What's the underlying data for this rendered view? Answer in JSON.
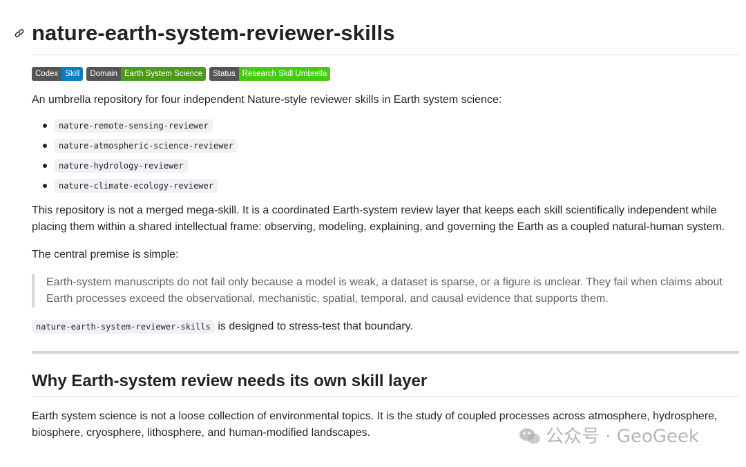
{
  "heading": "nature-earth-system-reviewer-skills",
  "badges": [
    {
      "key": "Codex",
      "value": "Skill",
      "color": "#007ec6"
    },
    {
      "key": "Domain",
      "value": "Earth System Science",
      "color": "#4c9a1a"
    },
    {
      "key": "Status",
      "value": "Research Skill Umbrella",
      "color": "#44cc11"
    }
  ],
  "intro": "An umbrella repository for four independent Nature-style reviewer skills in Earth system science:",
  "skills": [
    "nature-remote-sensing-reviewer",
    "nature-atmospheric-science-reviewer",
    "nature-hydrology-reviewer",
    "nature-climate-ecology-reviewer"
  ],
  "paragraph2": "This repository is not a merged mega-skill. It is a coordinated Earth-system review layer that keeps each skill scientifically independent while placing them within a shared intellectual frame: observing, modeling, explaining, and governing the Earth as a coupled natural-human system.",
  "paragraph3": "The central premise is simple:",
  "quote": "Earth-system manuscripts do not fail only because a model is weak, a dataset is sparse, or a figure is unclear. They fail when claims about Earth processes exceed the observational, mechanistic, spatial, temporal, and causal evidence that supports them.",
  "paragraph4": {
    "code": "nature-earth-system-reviewer-skills",
    "text": " is designed to stress-test that boundary."
  },
  "section2": {
    "heading": "Why Earth-system review needs its own skill layer",
    "paragraph": "Earth system science is not a loose collection of environmental topics. It is the study of coupled processes across atmosphere, hydrosphere, biosphere, cryosphere, lithosphere, and human-modified landscapes."
  },
  "watermark": "公众号 · GeoGeek"
}
